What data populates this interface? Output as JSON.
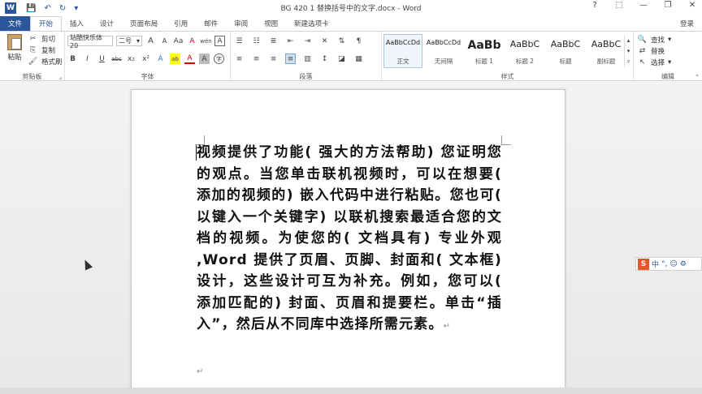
{
  "titlebar": {
    "app_icon": "W",
    "title": "BG 420 1 替换括号中的文字.docx - Word",
    "help": "?",
    "minimize": "—",
    "restore": "❐",
    "close": "✕"
  },
  "tabs": [
    "文件",
    "开始",
    "插入",
    "设计",
    "页面布局",
    "引用",
    "邮件",
    "审阅",
    "视图",
    "新建选项卡"
  ],
  "login": "登录",
  "clipboard": {
    "paste": "粘贴",
    "cut": "剪切",
    "copy": "复制",
    "format_painter": "格式刷",
    "label": "剪贴板"
  },
  "font": {
    "name": "站酷快乐体20",
    "size": "二号",
    "grow": "A",
    "shrink": "A",
    "case": "Aa",
    "clear": "A",
    "phonetic": "wén",
    "border": "A",
    "bold": "B",
    "italic": "I",
    "underline": "U",
    "strike": "abc",
    "sub": "x₂",
    "sup": "x²",
    "effects": "A",
    "highlight": "ab",
    "color": "A",
    "shade": "A",
    "enclose": "字",
    "label": "字体"
  },
  "paragraph": {
    "label": "段落"
  },
  "styles": {
    "items": [
      {
        "preview": "AaBbCcDd",
        "name": "正文"
      },
      {
        "preview": "AaBbCcDd",
        "name": "无间隔"
      },
      {
        "preview": "AaBb",
        "name": "标题 1"
      },
      {
        "preview": "AaBbC",
        "name": "标题 2"
      },
      {
        "preview": "AaBbC",
        "name": "标题"
      },
      {
        "preview": "AaBbC",
        "name": "副标题"
      }
    ],
    "label": "样式"
  },
  "editing": {
    "find": "查找",
    "replace": "替换",
    "select": "选择",
    "label": "编辑"
  },
  "document": {
    "text": "视频提供了功能( 强大的方法帮助) 您证明您的观点。当您单击联机视频时，可以在想要( 添加的视频的) 嵌入代码中进行粘贴。您也可( 以键入一个关键字) 以联机搜索最适合您的文档的视频。为使您的( 文档具有) 专业外观 ,Word 提供了页眉、页脚、封面和( 文本框) 设计，这些设计可互为补充。例如，您可以( 添加匹配的) 封面、页眉和提要栏。单击“插入”，然后从不同库中选择所需元素。",
    "para_mark": "↵"
  },
  "ime": {
    "logo": "S",
    "mode": "中",
    "punct": "°,",
    "emoji": "☺",
    "settings": "⚙"
  }
}
